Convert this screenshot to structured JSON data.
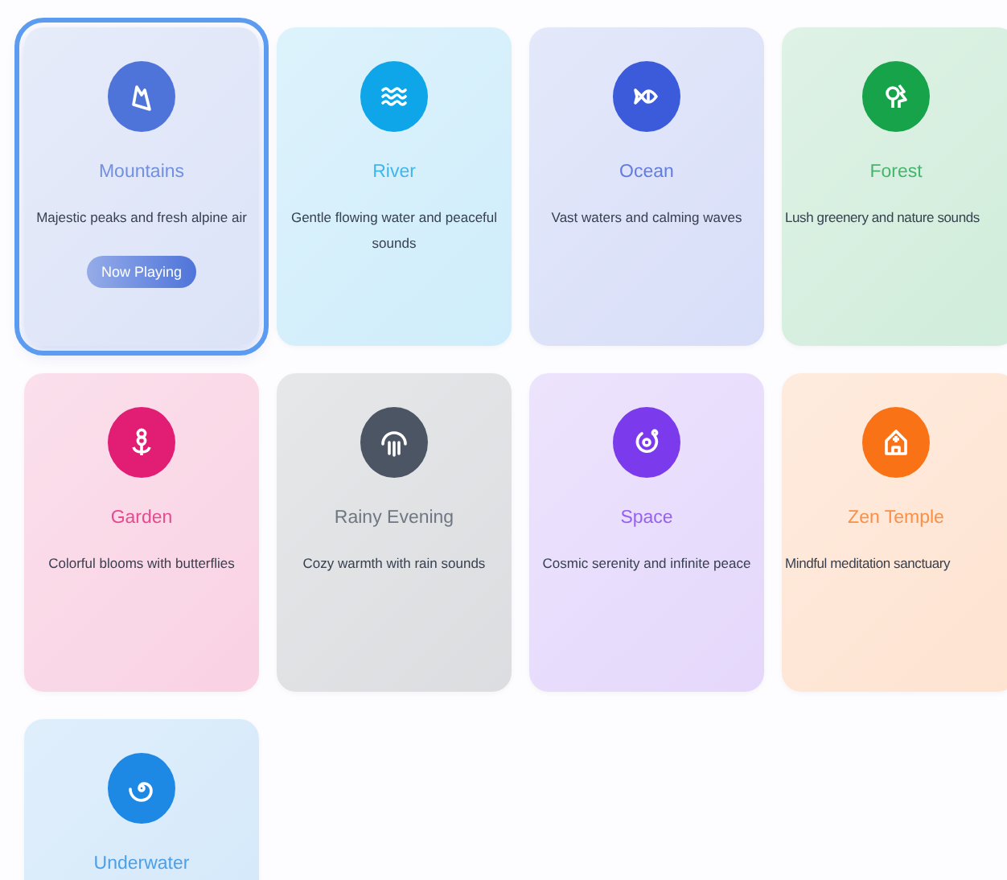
{
  "cards": [
    {
      "kind": "mountain",
      "title": "Mountains",
      "description": "Majestic peaks and fresh alpine air",
      "color": "#4f74d9",
      "selected": true,
      "status": "Now Playing"
    },
    {
      "kind": "waves",
      "title": "River",
      "description": "Gentle flowing water and peaceful sounds",
      "color": "#0ea5e9",
      "selected": false
    },
    {
      "kind": "fish",
      "title": "Ocean",
      "description": "Vast waters and calming waves",
      "color": "#3b5bdb",
      "selected": false
    },
    {
      "kind": "tree",
      "title": "Forest",
      "description": "Lush greenery and nature sounds",
      "color": "#16a34a",
      "selected": false
    },
    {
      "kind": "flower",
      "title": "Garden",
      "description": "Colorful blooms with butterflies",
      "color": "#e11d74",
      "selected": false
    },
    {
      "kind": "rain",
      "title": "Rainy Evening",
      "description": "Cozy warmth with rain sounds",
      "color": "#4b5563",
      "selected": false
    },
    {
      "kind": "planet",
      "title": "Space",
      "description": "Cosmic serenity and infinite peace",
      "color": "#7c3aed",
      "selected": false
    },
    {
      "kind": "temple",
      "title": "Zen Temple",
      "description": "Mindful meditation sanctuary",
      "color": "#f97316",
      "selected": false
    },
    {
      "kind": "spiral",
      "title": "Underwater",
      "color": "#1e88e5",
      "selected": false
    }
  ]
}
